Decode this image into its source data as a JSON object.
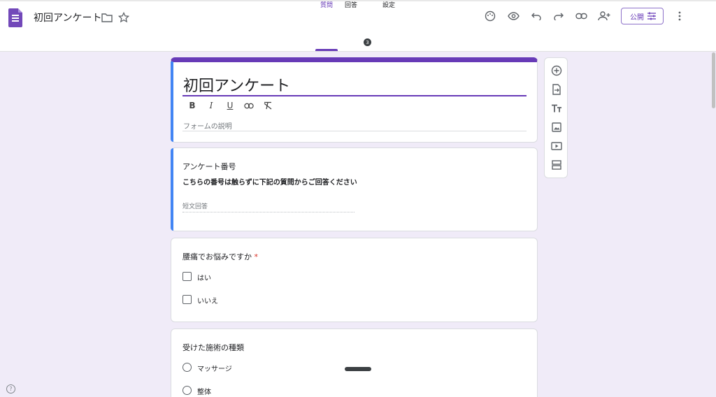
{
  "header": {
    "doc_title": "初回アンケート",
    "publish_label": "公開",
    "icons": [
      "folder-icon",
      "star-icon",
      "palette-icon",
      "preview-icon",
      "undo-icon",
      "redo-icon",
      "link-icon",
      "add-collaborator-icon",
      "more-icon"
    ]
  },
  "tabs": {
    "questions": "質問",
    "responses": "回答",
    "responses_count": "3",
    "settings": "設定"
  },
  "form": {
    "title": "初回アンケート",
    "description_placeholder": "フォームの説明",
    "format_buttons": [
      "B",
      "I",
      "U"
    ]
  },
  "question1": {
    "label": "アンケート番号",
    "description": "こちらの番号は触らずに下記の質問からご回答ください",
    "answer_placeholder": "短文回答"
  },
  "question2": {
    "label": "腰痛でお悩みですか",
    "required_mark": "*",
    "options": [
      "はい",
      "いいえ"
    ]
  },
  "question3": {
    "label": "受けた施術の種類",
    "options": [
      "マッサージ",
      "整体"
    ]
  },
  "help_label": "?",
  "colors": {
    "accent": "#673ab7",
    "background": "#f0ebf8",
    "active_card": "#4285f4",
    "required": "#d93025"
  }
}
